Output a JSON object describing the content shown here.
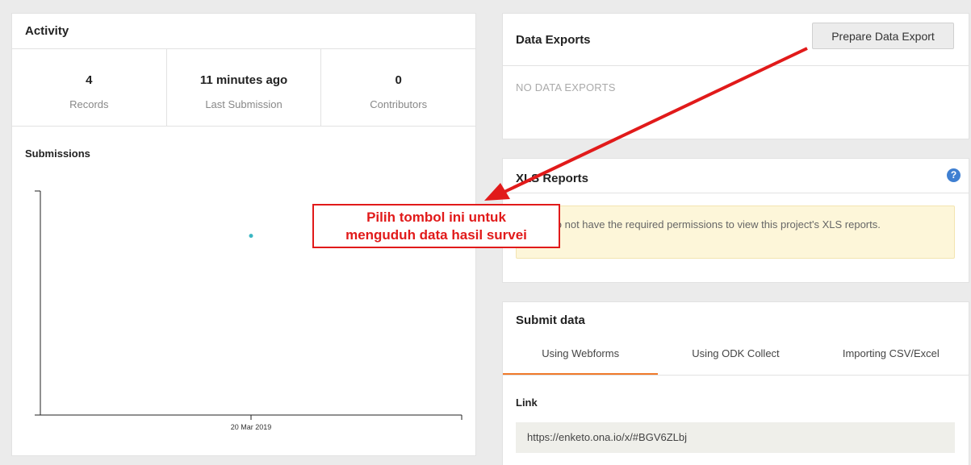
{
  "activity": {
    "title": "Activity",
    "stats": [
      {
        "value": "4",
        "label": "Records"
      },
      {
        "value": "11 minutes ago",
        "label": "Last Submission"
      },
      {
        "value": "0",
        "label": "Contributors"
      }
    ],
    "submissions_title": "Submissions"
  },
  "chart_data": {
    "type": "scatter",
    "title": "Submissions",
    "x_tick_labels": [
      "20 Mar 2019"
    ],
    "series": [
      {
        "x": [
          "20 Mar 2019"
        ],
        "y": [
          4
        ]
      }
    ],
    "ylim": [
      0,
      5
    ],
    "grid": false,
    "accent_color": "#3bb6c3"
  },
  "exports": {
    "title": "Data Exports",
    "button_label": "Prepare Data Export",
    "empty_text": "NO DATA EXPORTS"
  },
  "xls": {
    "title": "XLS Reports",
    "help_icon": "question-circle-icon",
    "help_glyph": "?",
    "warning": "You do not have the required permissions to view this project's XLS reports."
  },
  "submit": {
    "title": "Submit data",
    "tabs": [
      {
        "label": "Using Webforms",
        "active": true
      },
      {
        "label": "Using ODK Collect",
        "active": false
      },
      {
        "label": "Importing CSV/Excel",
        "active": false
      }
    ],
    "link_label": "Link",
    "link_value": "https://enketo.ona.io/x/#BGV6ZLbj"
  },
  "annotation": {
    "line1": "Pilih tombol ini untuk",
    "line2": "menguduh data hasil survei",
    "color": "#e11a1a"
  }
}
